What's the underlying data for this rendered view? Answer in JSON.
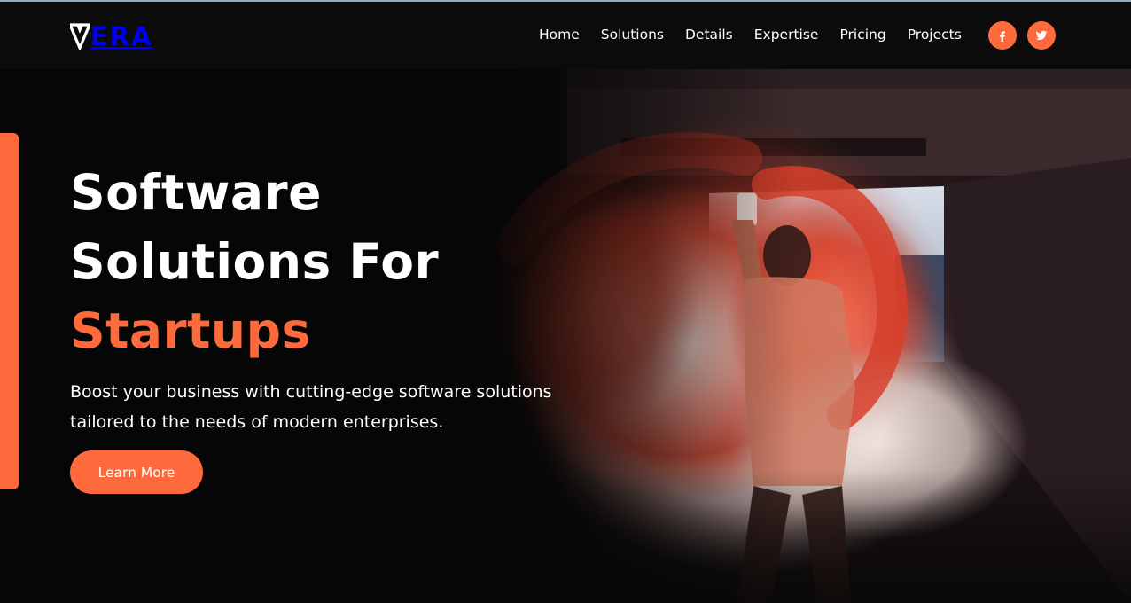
{
  "brand": {
    "name": "ERA",
    "logo_icon": "v-triangle-logo"
  },
  "nav": {
    "items": [
      {
        "label": "Home"
      },
      {
        "label": "Solutions"
      },
      {
        "label": "Details"
      },
      {
        "label": "Expertise"
      },
      {
        "label": "Pricing"
      },
      {
        "label": "Projects"
      }
    ],
    "social": [
      {
        "icon": "facebook-icon"
      },
      {
        "icon": "twitter-icon"
      }
    ]
  },
  "hero": {
    "headline_line1": "Software",
    "headline_line2": "Solutions For",
    "headline_accent": "Startups",
    "description": "Boost your business with cutting-edge software solutions tailored to the needs of modern enterprises.",
    "cta_label": "Learn More",
    "image_subject": "hooded person holding orange smoke flare in tunnel"
  },
  "colors": {
    "accent": "#ff6a3d",
    "background": "#060606",
    "navbar": "#0b0b0b",
    "text": "#ffffff"
  }
}
